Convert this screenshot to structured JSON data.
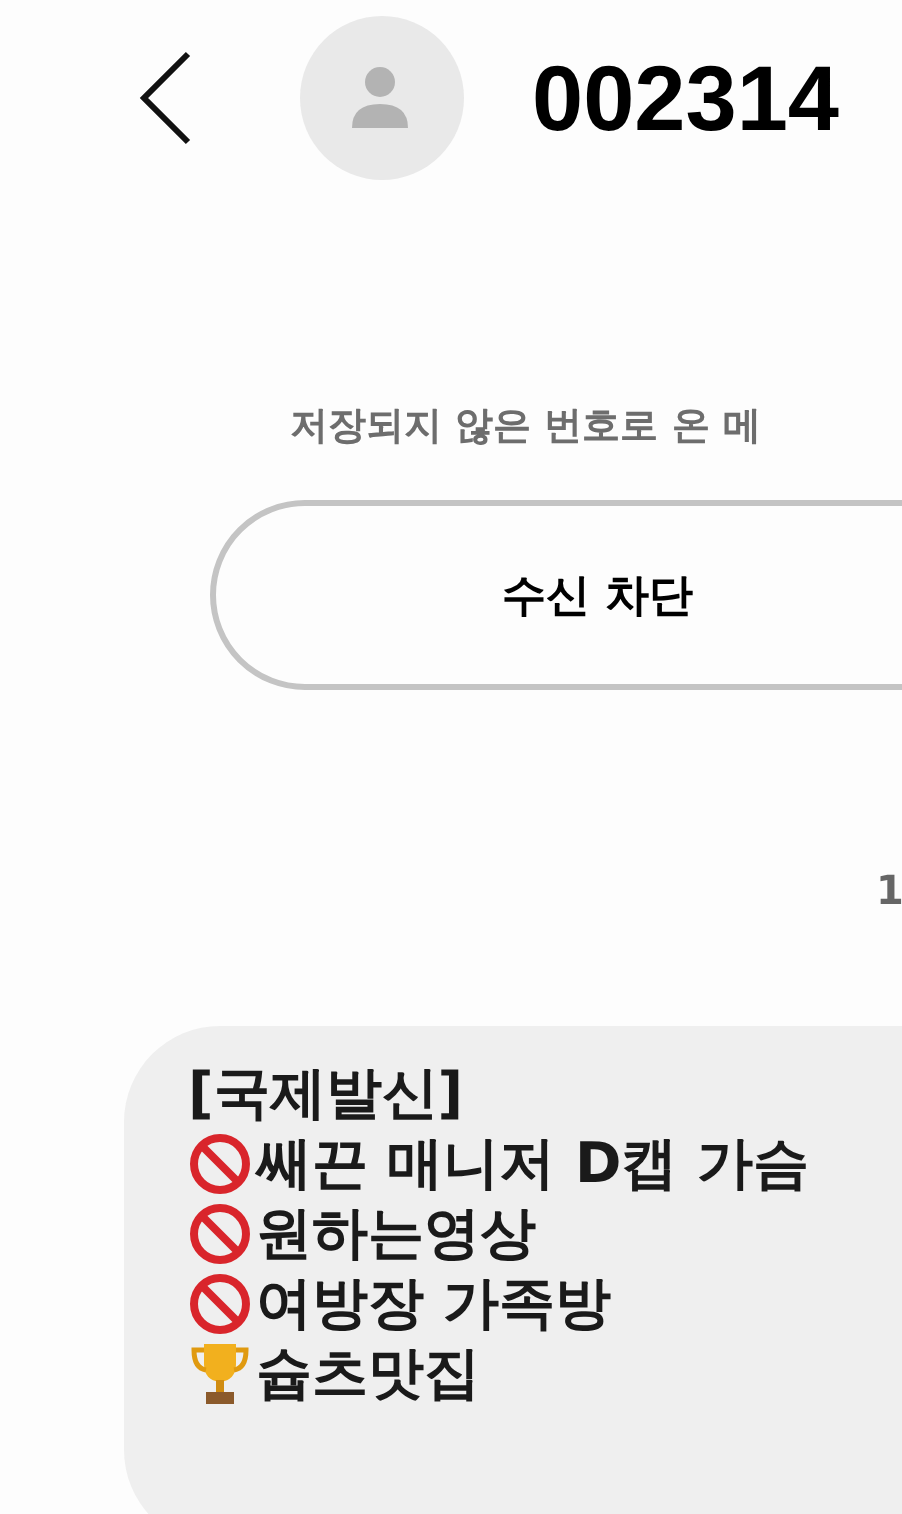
{
  "header": {
    "title": "002314"
  },
  "notice": {
    "text": "저장되지 않은 번호로 온 메"
  },
  "block_button": {
    "label": "수신 차단"
  },
  "date": {
    "text": "1"
  },
  "message": {
    "lines": [
      {
        "kind": "plain",
        "text": "[국제발신]"
      },
      {
        "kind": "prohibited",
        "text": "쌔끈 매니저 D캡 가슴"
      },
      {
        "kind": "prohibited",
        "text": "원하는영상"
      },
      {
        "kind": "prohibited",
        "text": "여방장 가족방"
      },
      {
        "kind": "trophy",
        "text": "슙츠맛집"
      }
    ]
  }
}
